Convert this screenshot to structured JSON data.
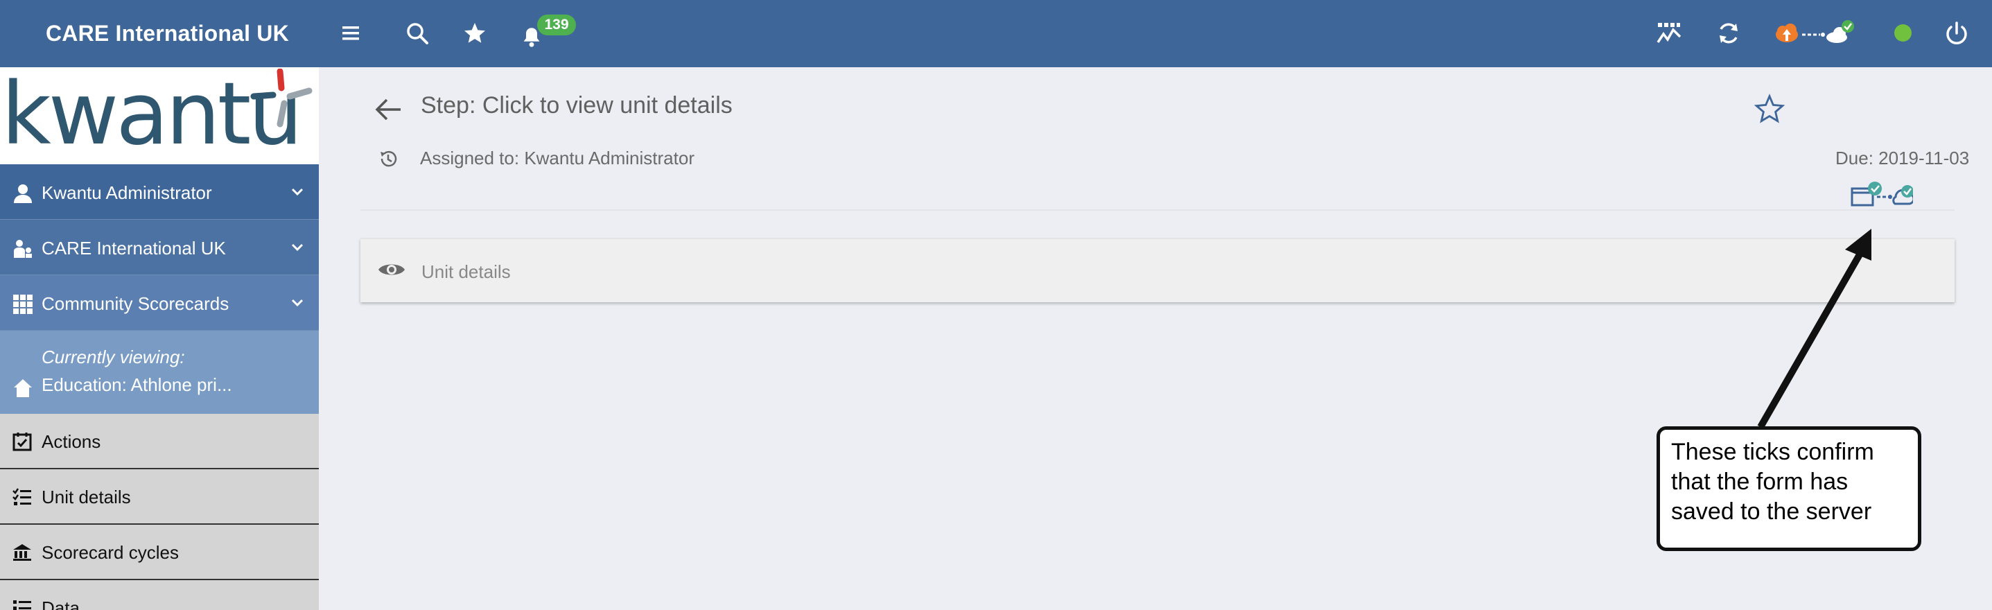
{
  "topbar": {
    "brand": "CARE International UK",
    "notification_count": "139",
    "colors": {
      "bar": "#3e6698",
      "badge": "#4fb04f",
      "status": "#72c13e",
      "upload": "#f07d2c"
    },
    "icons": [
      "menu-icon",
      "search-icon",
      "star-icon",
      "bell-icon",
      "chart-icon",
      "refresh-icon",
      "cloud-upload-icon",
      "online-status-icon",
      "power-icon"
    ]
  },
  "sidebar": {
    "logo_text": "kwantu",
    "user": "Kwantu Administrator",
    "org": "CARE International UK",
    "app": "Community Scorecards",
    "current_label": "Currently viewing:",
    "current_value": "Education: Athlone pri...",
    "items": [
      {
        "label": "Actions",
        "icon": "calendar-check-icon"
      },
      {
        "label": "Unit details",
        "icon": "checklist-icon"
      },
      {
        "label": "Scorecard cycles",
        "icon": "building-icon"
      },
      {
        "label": "Data",
        "icon": "list-icon"
      }
    ]
  },
  "main": {
    "step_title": "Step: Click to view unit details",
    "assigned": "Assigned to: Kwantu Administrator",
    "due": "Due: 2019-11-03",
    "section_label": "Unit details"
  },
  "callout": {
    "line1": "These ticks confirm",
    "line2": "that the form has",
    "line3": "saved to the server"
  }
}
